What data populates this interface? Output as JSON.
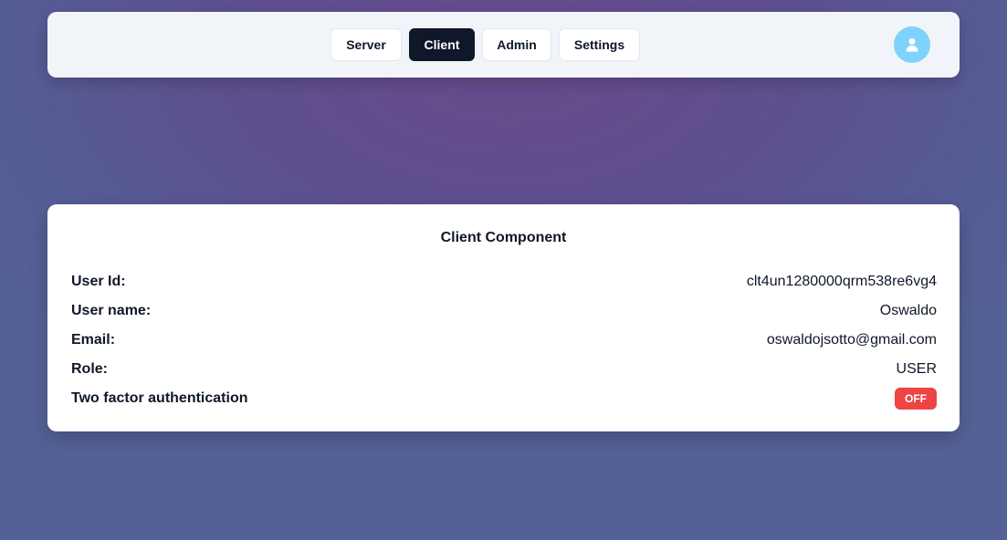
{
  "nav": {
    "buttons": [
      {
        "label": "Server"
      },
      {
        "label": "Client"
      },
      {
        "label": "Admin"
      },
      {
        "label": "Settings"
      }
    ],
    "active": "Client",
    "avatar_icon": "user-icon",
    "avatar_color": "#7dd3fc"
  },
  "card": {
    "title": "Client Component",
    "rows": [
      {
        "label": "User Id:",
        "value": "clt4un1280000qrm538re6vg4"
      },
      {
        "label": "User name:",
        "value": "Oswaldo"
      },
      {
        "label": "Email:",
        "value": "oswaldojsotto@gmail.com"
      },
      {
        "label": "Role:",
        "value": "USER"
      },
      {
        "label": "Two factor authentication",
        "value": "OFF"
      }
    ],
    "badge_color": "#ef4444"
  }
}
